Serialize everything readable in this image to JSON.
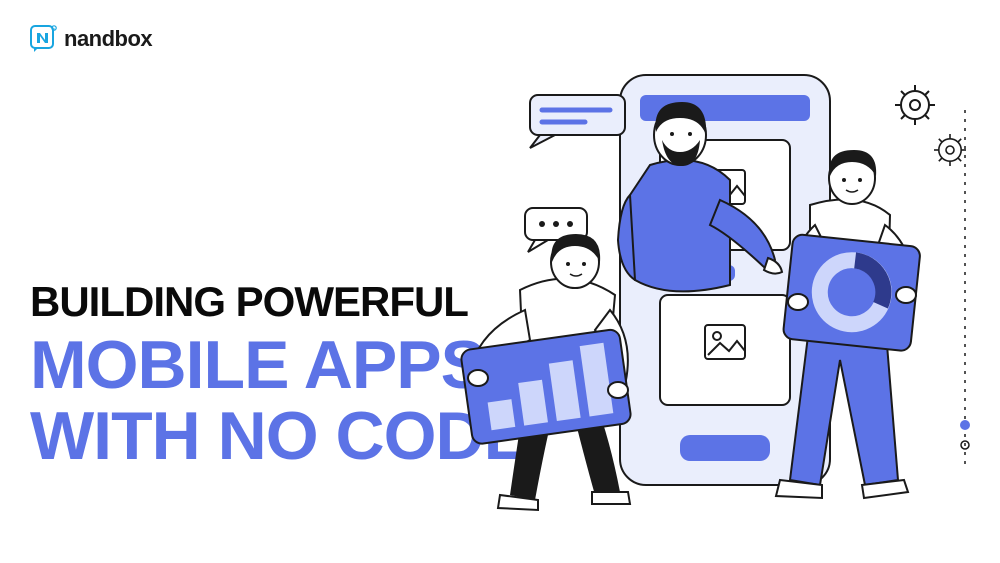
{
  "brand": {
    "name": "nandbox",
    "logo_color": "#18a5e0"
  },
  "headline": {
    "line1": "BUILDING POWERFUL",
    "line2": "MOBILE APPS",
    "line3": "WITH NO CODE"
  },
  "palette": {
    "accent": "#5c73e6",
    "dark": "#1a1a1a",
    "light": "#eaeefc",
    "outline": "#1a1a1a"
  }
}
